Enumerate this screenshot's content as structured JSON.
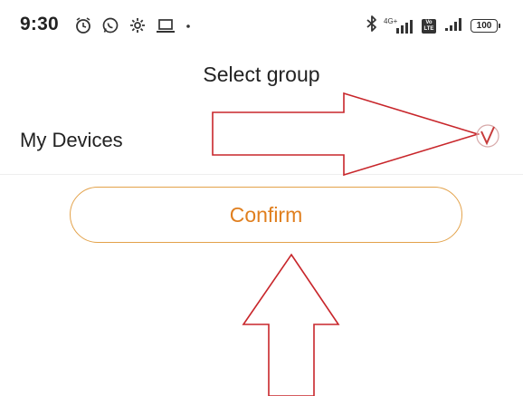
{
  "status_bar": {
    "time": "9:30",
    "left_icons": [
      "alarm-icon",
      "whatsapp-icon",
      "settings-icon",
      "laptop-icon",
      "dot-icon"
    ],
    "network_label": "4G+",
    "volte_label": "Vo LTE",
    "battery": "100",
    "right_icons": [
      "bluetooth-icon",
      "signal-icon",
      "volte-icon",
      "signal-icon",
      "battery-icon"
    ]
  },
  "header": {
    "title": "Select group"
  },
  "groups": [
    {
      "label": "My Devices",
      "selected": true
    }
  ],
  "actions": {
    "confirm_label": "Confirm"
  },
  "colors": {
    "accent": "#e07f1f",
    "button_border": "#e3a24a",
    "annotation": "#c8262b",
    "check": "#c73b3b"
  }
}
